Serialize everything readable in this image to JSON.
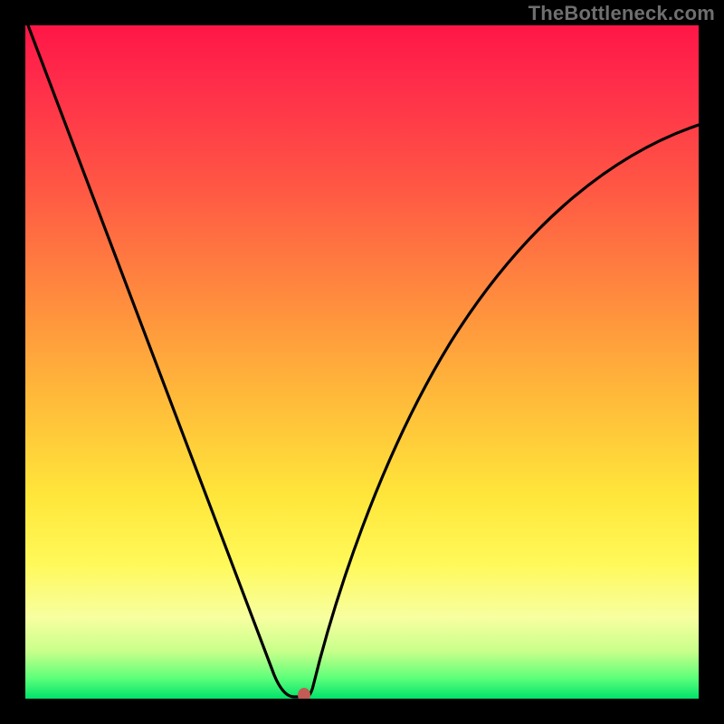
{
  "watermark": "TheBottleneck.com",
  "colors": {
    "frame": "#000000",
    "curve": "#000000",
    "marker": "#c25b55",
    "gradient_top": "#ff1646",
    "gradient_bottom": "#00e26a"
  },
  "chart_data": {
    "type": "line",
    "title": "",
    "xlabel": "",
    "ylabel": "",
    "xlim": [
      0,
      100
    ],
    "ylim": [
      0,
      100
    ],
    "x": [
      0,
      5,
      10,
      15,
      20,
      25,
      30,
      35,
      37,
      39,
      40,
      41,
      42,
      45,
      50,
      55,
      60,
      65,
      70,
      75,
      80,
      85,
      90,
      95,
      100
    ],
    "y": [
      100,
      87,
      75,
      62,
      49,
      37,
      24,
      11,
      6,
      1,
      0,
      0,
      3,
      12,
      25,
      36,
      46,
      54,
      61,
      67,
      72,
      76,
      79,
      82,
      85
    ],
    "marker": {
      "x": 41,
      "y": 0
    },
    "note": "V-shaped bottleneck curve; minimum (optimal point) near x≈41. Right branch rises with diminishing slope (concave). Values are read/estimated from pixel positions; no axis ticks or labels are visible."
  }
}
